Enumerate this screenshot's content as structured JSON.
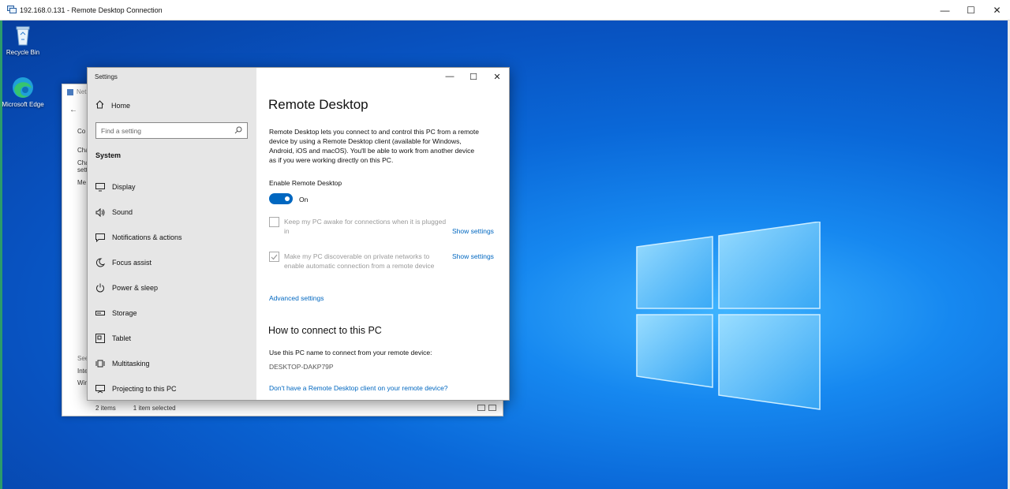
{
  "rdp": {
    "title": "192.168.0.131 - Remote Desktop Connection",
    "minimize": "—",
    "maximize": "☐",
    "close": "✕"
  },
  "desktop": {
    "icons": [
      {
        "label": "Recycle Bin",
        "icon": "recycle-bin-icon"
      },
      {
        "label": "Microsoft Edge",
        "icon": "edge-icon"
      }
    ]
  },
  "explorer": {
    "title_partial": "Net",
    "left_text": [
      "Co",
      "Cha",
      "Cha",
      "sett",
      "Me",
      "See",
      "Inte",
      "Win"
    ],
    "status_items": "2 items",
    "status_selected": "1 item selected"
  },
  "settings": {
    "window_title": "Settings",
    "home": "Home",
    "search_placeholder": "Find a setting",
    "section": "System",
    "nav_items": [
      {
        "label": "Display",
        "icon": "display-icon"
      },
      {
        "label": "Sound",
        "icon": "sound-icon"
      },
      {
        "label": "Notifications & actions",
        "icon": "notifications-icon"
      },
      {
        "label": "Focus assist",
        "icon": "focus-assist-icon"
      },
      {
        "label": "Power & sleep",
        "icon": "power-icon"
      },
      {
        "label": "Storage",
        "icon": "storage-icon"
      },
      {
        "label": "Tablet",
        "icon": "tablet-icon"
      },
      {
        "label": "Multitasking",
        "icon": "multitasking-icon"
      },
      {
        "label": "Projecting to this PC",
        "icon": "projecting-icon"
      }
    ],
    "page_title": "Remote Desktop",
    "description": "Remote Desktop lets you connect to and control this PC from a remote device by using a Remote Desktop client (available for Windows, Android, iOS and macOS). You'll be able to work from another device as if you were working directly on this PC.",
    "enable_label": "Enable Remote Desktop",
    "toggle_state": "On",
    "option_awake": "Keep my PC awake for connections when it is plugged in",
    "option_discoverable": "Make my PC discoverable on private networks to enable automatic connection from a remote device",
    "show_settings": "Show settings",
    "advanced_settings": "Advanced settings",
    "how_to_title": "How to connect to this PC",
    "how_to_text": "Use this PC name to connect from your remote device:",
    "pc_name": "DESKTOP-DAKP79P",
    "client_link": "Don't have a Remote Desktop client on your remote device?",
    "accent": "#0067c0"
  }
}
